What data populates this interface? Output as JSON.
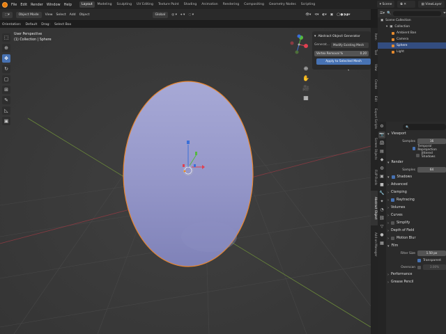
{
  "topbar": {
    "menus": [
      "File",
      "Edit",
      "Render",
      "Window",
      "Help"
    ],
    "workspaces": [
      "Layout",
      "Modeling",
      "Sculpting",
      "UV Editing",
      "Texture Paint",
      "Shading",
      "Animation",
      "Rendering",
      "Compositing",
      "Geometry Nodes",
      "Scripting"
    ],
    "active_workspace": "Layout",
    "scene": "Scene",
    "view_layer": "ViewLayer"
  },
  "viewport_header": {
    "mode": "Object Mode",
    "menus": [
      "View",
      "Select",
      "Add",
      "Object"
    ],
    "transform": "Global",
    "orientation_label": "Orientation:",
    "orientation_value": "Default",
    "drag_label": "Drag:",
    "drag_value": "Select Box"
  },
  "view_info": {
    "line1": "User Perspective",
    "line2": "(1) Collection | Sphere"
  },
  "aog_panel": {
    "title": "Abstract Object Generator",
    "generate_label": "Generat...",
    "generate_value": "Modify Existing Mesh",
    "slider_label": "Vertex Removal %",
    "slider_value": "0.20",
    "apply_label": "Apply to Selected Mesh"
  },
  "vtabs": [
    "Item",
    "Tool",
    "View",
    "Create",
    "Edit",
    "Export Scripts",
    "Screen Objects",
    "FLIP Fluids",
    "Abstract Object",
    "Add-on Manager"
  ],
  "outliner": {
    "scene_collection": "Scene Collection",
    "collection": "Collection",
    "objects": [
      "Ambient Ban",
      "Camera",
      "Sphere",
      "Light"
    ],
    "selected": "Sphere"
  },
  "props": {
    "search_placeholder": "",
    "viewport": "Viewport",
    "samples_label": "Samples",
    "viewport_samples": "16",
    "temporal": "Temporal Reprojection",
    "jittered": "Jittered Shadows",
    "render": "Render",
    "render_samples": "64",
    "shadows": "Shadows",
    "advanced": "Advanced",
    "sections": [
      "Clamping",
      "Raytracing",
      "Volumes",
      "Curves",
      "Simplify",
      "Depth of Field",
      "Motion Blur"
    ],
    "film": "Film",
    "filter_size_label": "Filter Size",
    "filter_size_value": "1.50 px",
    "transparent": "Transparent",
    "overscan_label": "Overscan",
    "overscan_value": "3.00%",
    "performance": "Performance",
    "grease_pencil": "Grease Pencil"
  }
}
